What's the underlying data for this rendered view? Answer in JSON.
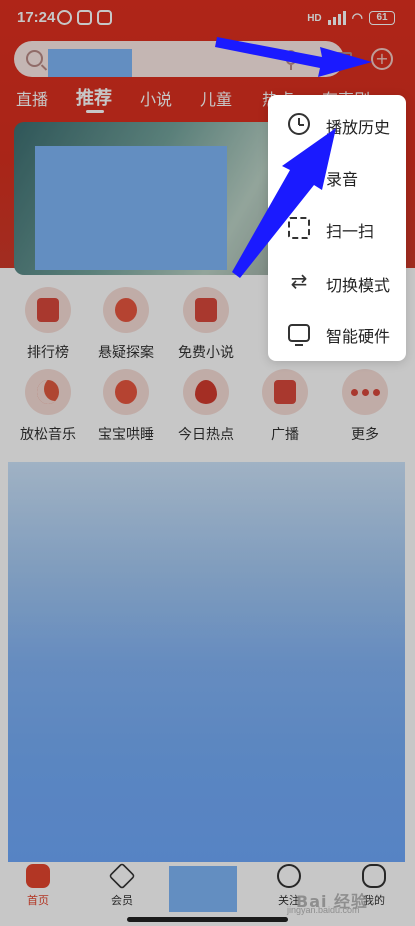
{
  "status_bar": {
    "time": "17:24",
    "network_label": "HD",
    "battery": "61"
  },
  "search": {
    "placeholder": "",
    "add_label": "+"
  },
  "tabs": [
    "直播",
    "推荐",
    "小说",
    "儿童",
    "热点",
    "有声剧"
  ],
  "active_tab": "推荐",
  "shortcuts": [
    {
      "label": "排行榜",
      "icon": "ranking-icon"
    },
    {
      "label": "悬疑探案",
      "icon": "detective-icon"
    },
    {
      "label": "免费小说",
      "icon": "book-icon"
    },
    {
      "label": "放松音乐",
      "icon": "moon-icon"
    },
    {
      "label": "宝宝哄睡",
      "icon": "baby-sleep-icon"
    },
    {
      "label": "今日热点",
      "icon": "flame-icon"
    },
    {
      "label": "广播",
      "icon": "radio-icon"
    },
    {
      "label": "更多",
      "icon": "more-icon"
    }
  ],
  "popup_menu": {
    "items": [
      {
        "label": "播放历史",
        "icon": "clock-icon"
      },
      {
        "label": "录音",
        "icon": "microphone-icon"
      },
      {
        "label": "扫一扫",
        "icon": "scan-icon"
      },
      {
        "label": "切换模式",
        "icon": "switch-icon"
      },
      {
        "label": "智能硬件",
        "icon": "device-icon"
      }
    ]
  },
  "bottom_nav": {
    "items": [
      {
        "label": "首页",
        "icon": "home-icon"
      },
      {
        "label": "会员",
        "icon": "vip-icon"
      },
      {
        "label": "关注",
        "icon": "follow-icon"
      },
      {
        "label": "我的",
        "icon": "profile-icon"
      }
    ],
    "active": "首页"
  },
  "watermark": {
    "text": "Bai 经验",
    "sub": "jingyan.baidu.com"
  },
  "colors": {
    "header_red": "#e0301f",
    "accent": "#e5462f",
    "annotation_arrow": "#1a1aff",
    "redaction": "#7fb6f8"
  }
}
